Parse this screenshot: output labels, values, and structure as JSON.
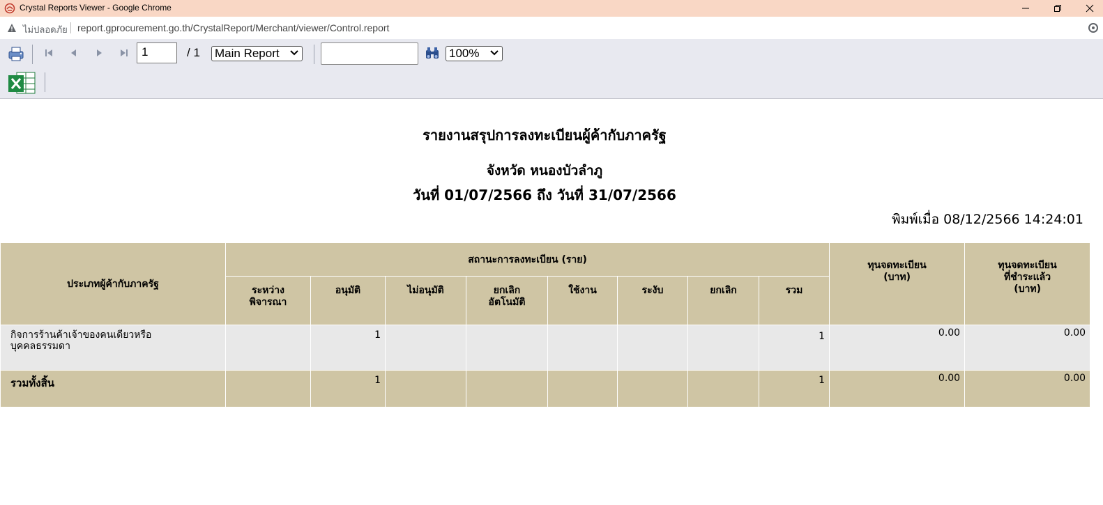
{
  "window": {
    "title": "Crystal Reports Viewer - Google Chrome"
  },
  "address_bar": {
    "security_label": "ไม่ปลอดภัย",
    "url": "report.gprocurement.go.th/CrystalReport/Merchant/viewer/Control.report"
  },
  "toolbar": {
    "page_current": "1",
    "page_total": "/ 1",
    "report_select": "Main Report",
    "search_value": "",
    "zoom_select": "100%"
  },
  "report": {
    "title": "รายงานสรุปการลงทะเบียนผู้ค้ากับภาครัฐ",
    "province": "จังหวัด หนองบัวลำภู",
    "date_range": "วันที่ 01/07/2566 ถึง วันที่ 31/07/2566",
    "printed_at": "พิมพ์เมื่อ 08/12/2566  14:24:01"
  },
  "table": {
    "col_type": "ประเภทผู้ค้ากับภาครัฐ",
    "group_status": "สถานะการลงทะเบียน (ราย)",
    "status_cols": [
      "ระหว่าง\nพิจารณา",
      "อนุมัติ",
      "ไม่อนุมัติ",
      "ยกเลิก\nอัตโนมัติ",
      "ใช้งาน",
      "ระงับ",
      "ยกเลิก",
      "รวม"
    ],
    "col_capital": "ทุนจดทะเบียน\n(บาท)",
    "col_paid": "ทุนจดทะเบียน\nที่ชำระแล้ว\n(บาท)",
    "rows": [
      {
        "type": "กิจการร้านค้าเจ้าของคนเดียวหรือ\nบุคคลธรรมดา",
        "cells": [
          "",
          "1",
          "",
          "",
          "",
          "",
          "",
          "1"
        ],
        "capital": "0.00",
        "paid": "0.00"
      }
    ],
    "total": {
      "label": "รวมทั้งสิ้น",
      "cells": [
        "",
        "1",
        "",
        "",
        "",
        "",
        "",
        "1"
      ],
      "capital": "0.00",
      "paid": "0.00"
    }
  },
  "colors": {
    "titlebar": "#f9d7c5",
    "toolbar": "#e8e9f0",
    "table_header": "#cfc5a4",
    "table_row": "#e8e8e8"
  }
}
